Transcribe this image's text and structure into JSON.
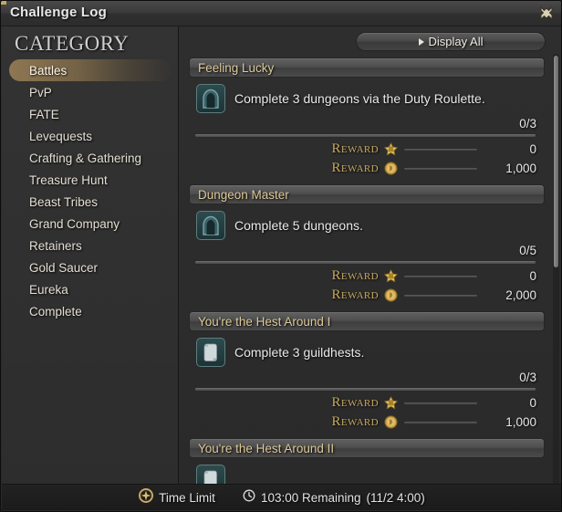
{
  "window": {
    "title": "Challenge Log",
    "close_icon": "close-cross-icon"
  },
  "sidebar": {
    "header": "CATEGORY",
    "items": [
      {
        "label": "Battles",
        "selected": true
      },
      {
        "label": "PvP",
        "selected": false
      },
      {
        "label": "FATE",
        "selected": false
      },
      {
        "label": "Levequests",
        "selected": false
      },
      {
        "label": "Crafting & Gathering",
        "selected": false
      },
      {
        "label": "Treasure Hunt",
        "selected": false
      },
      {
        "label": "Beast Tribes",
        "selected": false
      },
      {
        "label": "Grand Company",
        "selected": false
      },
      {
        "label": "Retainers",
        "selected": false
      },
      {
        "label": "Gold Saucer",
        "selected": false
      },
      {
        "label": "Eureka",
        "selected": false
      },
      {
        "label": "Complete",
        "selected": false
      }
    ]
  },
  "toolbar": {
    "display_all_label": "Display All",
    "display_all_icon": "triangle-right-icon"
  },
  "entries": [
    {
      "title": "Feeling Lucky",
      "icon": "dungeon-entrance-icon",
      "description": "Complete 3 dungeons via the Duty Roulette.",
      "progress_text": "0/3",
      "progress_percent": 0,
      "rewards": [
        {
          "label": "Reward",
          "icon": "exp-crown-icon",
          "value": "0"
        },
        {
          "label": "Reward",
          "icon": "gil-coin-icon",
          "value": "1,000"
        }
      ]
    },
    {
      "title": "Dungeon Master",
      "icon": "dungeon-entrance-icon",
      "description": "Complete 5 dungeons.",
      "progress_text": "0/5",
      "progress_percent": 0,
      "rewards": [
        {
          "label": "Reward",
          "icon": "exp-crown-icon",
          "value": "0"
        },
        {
          "label": "Reward",
          "icon": "gil-coin-icon",
          "value": "2,000"
        }
      ]
    },
    {
      "title": "You're the Hest Around I",
      "icon": "guildhest-scroll-icon",
      "description": "Complete 3 guildhests.",
      "progress_text": "0/3",
      "progress_percent": 0,
      "rewards": [
        {
          "label": "Reward",
          "icon": "exp-crown-icon",
          "value": "0"
        },
        {
          "label": "Reward",
          "icon": "gil-coin-icon",
          "value": "1,000"
        }
      ]
    },
    {
      "title": "You're the Hest Around II",
      "icon": "guildhest-scroll-icon",
      "description": "",
      "progress_text": "",
      "progress_percent": 0,
      "rewards": []
    }
  ],
  "footer": {
    "time_limit_icon": "time-limit-emblem-icon",
    "time_limit_label": "Time Limit",
    "clock_icon": "clock-icon",
    "remaining": "103:00 Remaining",
    "reset_date": "(11/2 4:00)"
  },
  "colors": {
    "accent_gold": "#c6a861",
    "title_gold": "#ddc89a",
    "selected_tan": "#967d55",
    "panel_bg": "#2e2e2e"
  }
}
